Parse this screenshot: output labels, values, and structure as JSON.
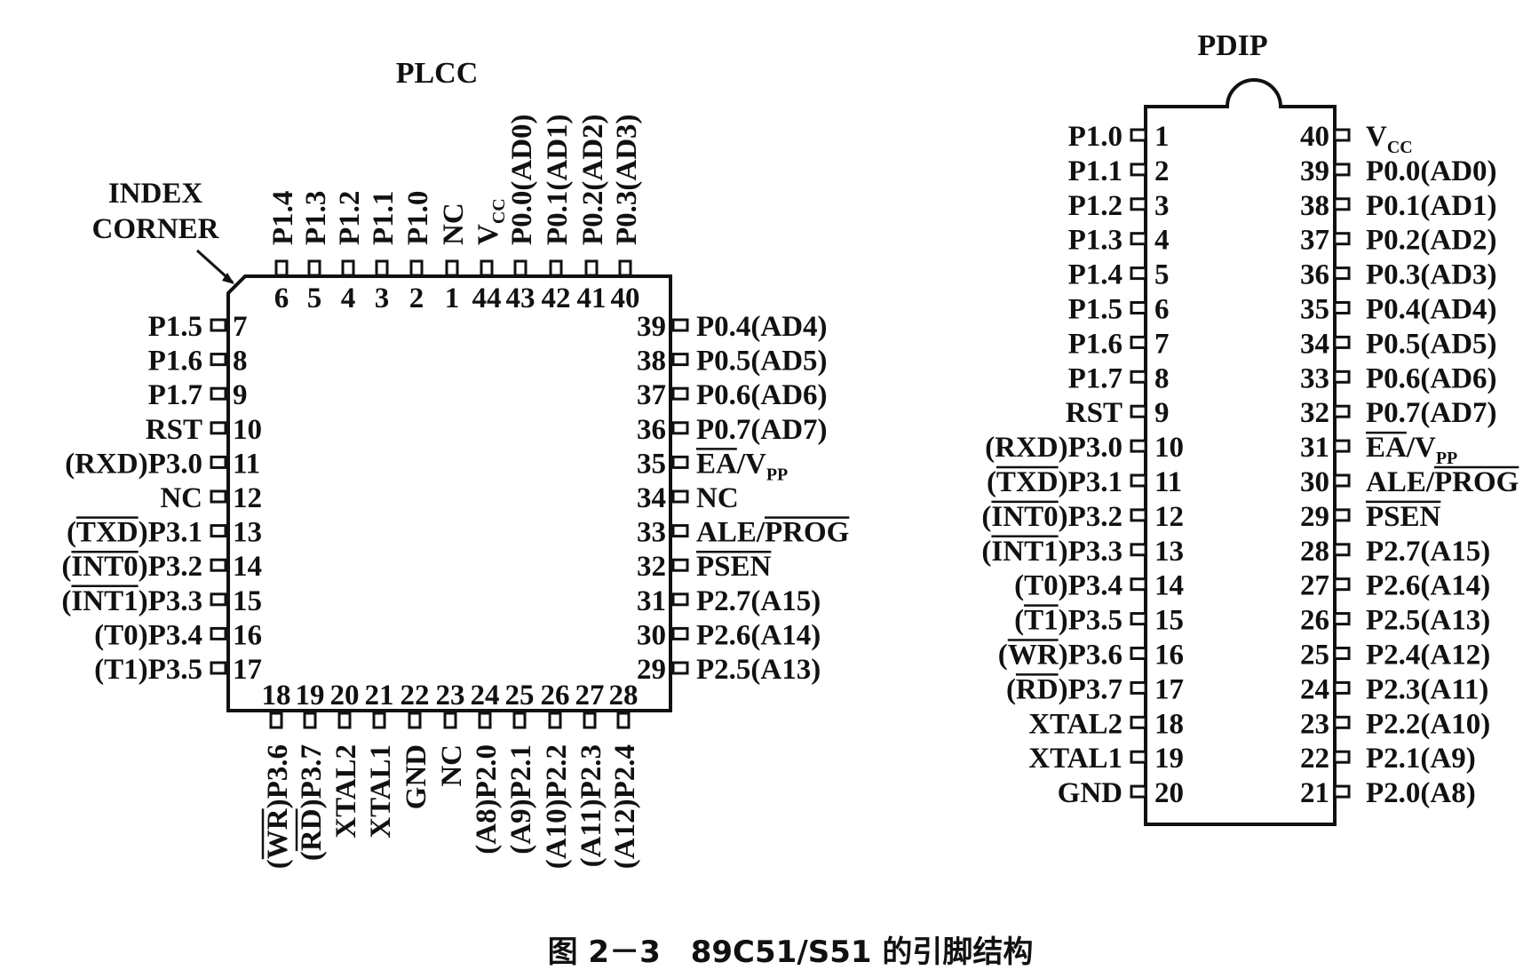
{
  "plcc": {
    "title": "PLCC",
    "index_corner": [
      "INDEX",
      "CORNER"
    ],
    "top": [
      {
        "num": "6",
        "label": "P1.4"
      },
      {
        "num": "5",
        "label": "P1.3"
      },
      {
        "num": "4",
        "label": "P1.2"
      },
      {
        "num": "3",
        "label": "P1.1"
      },
      {
        "num": "2",
        "label": "P1.0"
      },
      {
        "num": "1",
        "label": "NC"
      },
      {
        "num": "44",
        "label": "V",
        "sub": "CC"
      },
      {
        "num": "43",
        "label": "P0.0(AD0)"
      },
      {
        "num": "42",
        "label": "P0.1(AD1)"
      },
      {
        "num": "41",
        "label": "P0.2(AD2)"
      },
      {
        "num": "40",
        "label": "P0.3(AD3)"
      }
    ],
    "left": [
      {
        "num": "7",
        "label": "P1.5"
      },
      {
        "num": "8",
        "label": "P1.6"
      },
      {
        "num": "9",
        "label": "P1.7"
      },
      {
        "num": "10",
        "label": "RST"
      },
      {
        "num": "11",
        "label": "(RXD)P3.0"
      },
      {
        "num": "12",
        "label": "NC"
      },
      {
        "num": "13",
        "label": "(TXD)P3.1",
        "over": "TXD"
      },
      {
        "num": "14",
        "label": "(INT0)P3.2",
        "over": "INT0"
      },
      {
        "num": "15",
        "label": "(INT1)P3.3",
        "over": "INT1"
      },
      {
        "num": "16",
        "label": "(T0)P3.4"
      },
      {
        "num": "17",
        "label": "(T1)P3.5"
      }
    ],
    "right": [
      {
        "num": "39",
        "label": "P0.4(AD4)"
      },
      {
        "num": "38",
        "label": "P0.5(AD5)"
      },
      {
        "num": "37",
        "label": "P0.6(AD6)"
      },
      {
        "num": "36",
        "label": "P0.7(AD7)"
      },
      {
        "num": "35",
        "label": "EA/V",
        "sub": "PP",
        "over": "EA"
      },
      {
        "num": "34",
        "label": "NC"
      },
      {
        "num": "33",
        "label": "ALE/PROG",
        "over": "PROG"
      },
      {
        "num": "32",
        "label": "PSEN",
        "over": "PSEN"
      },
      {
        "num": "31",
        "label": "P2.7(A15)"
      },
      {
        "num": "30",
        "label": "P2.6(A14)"
      },
      {
        "num": "29",
        "label": "P2.5(A13)"
      }
    ],
    "bottom": [
      {
        "num": "18",
        "label": "(WR)P3.6",
        "over": "WR"
      },
      {
        "num": "19",
        "label": "(RD)P3.7",
        "over": "RD"
      },
      {
        "num": "20",
        "label": "XTAL2"
      },
      {
        "num": "21",
        "label": "XTAL1"
      },
      {
        "num": "22",
        "label": "GND"
      },
      {
        "num": "23",
        "label": "NC"
      },
      {
        "num": "24",
        "label": "(A8)P2.0"
      },
      {
        "num": "25",
        "label": "(A9)P2.1"
      },
      {
        "num": "26",
        "label": "(A10)P2.2"
      },
      {
        "num": "27",
        "label": "(A11)P2.3"
      },
      {
        "num": "28",
        "label": "(A12)P2.4"
      }
    ]
  },
  "pdip": {
    "title": "PDIP",
    "left": [
      {
        "num": "1",
        "label": "P1.0"
      },
      {
        "num": "2",
        "label": "P1.1"
      },
      {
        "num": "3",
        "label": "P1.2"
      },
      {
        "num": "4",
        "label": "P1.3"
      },
      {
        "num": "5",
        "label": "P1.4"
      },
      {
        "num": "6",
        "label": "P1.5"
      },
      {
        "num": "7",
        "label": "P1.6"
      },
      {
        "num": "8",
        "label": "P1.7"
      },
      {
        "num": "9",
        "label": "RST"
      },
      {
        "num": "10",
        "label": "(RXD)P3.0"
      },
      {
        "num": "11",
        "label": "(TXD)P3.1",
        "over": "TXD"
      },
      {
        "num": "12",
        "label": "(INT0)P3.2",
        "over": "INT0"
      },
      {
        "num": "13",
        "label": "(INT1)P3.3",
        "over": "INT1"
      },
      {
        "num": "14",
        "label": "(T0)P3.4"
      },
      {
        "num": "15",
        "label": "(T1)P3.5",
        "over": "T1"
      },
      {
        "num": "16",
        "label": "(WR)P3.6",
        "over": "WR"
      },
      {
        "num": "17",
        "label": "(RD)P3.7",
        "over": "RD"
      },
      {
        "num": "18",
        "label": "XTAL2"
      },
      {
        "num": "19",
        "label": "XTAL1"
      },
      {
        "num": "20",
        "label": "GND"
      }
    ],
    "right": [
      {
        "num": "40",
        "label": "V",
        "sub": "CC"
      },
      {
        "num": "39",
        "label": "P0.0(AD0)"
      },
      {
        "num": "38",
        "label": "P0.1(AD1)"
      },
      {
        "num": "37",
        "label": "P0.2(AD2)"
      },
      {
        "num": "36",
        "label": "P0.3(AD3)"
      },
      {
        "num": "35",
        "label": "P0.4(AD4)"
      },
      {
        "num": "34",
        "label": "P0.5(AD5)"
      },
      {
        "num": "33",
        "label": "P0.6(AD6)"
      },
      {
        "num": "32",
        "label": "P0.7(AD7)"
      },
      {
        "num": "31",
        "label": "EA/V",
        "sub": "PP",
        "over": "EA"
      },
      {
        "num": "30",
        "label": "ALE/PROG",
        "over": "PROG"
      },
      {
        "num": "29",
        "label": "PSEN",
        "over": "PSEN"
      },
      {
        "num": "28",
        "label": "P2.7(A15)"
      },
      {
        "num": "27",
        "label": "P2.6(A14)"
      },
      {
        "num": "26",
        "label": "P2.5(A13)"
      },
      {
        "num": "25",
        "label": "P2.4(A12)"
      },
      {
        "num": "24",
        "label": "P2.3(A11)"
      },
      {
        "num": "23",
        "label": "P2.2(A10)"
      },
      {
        "num": "22",
        "label": "P2.1(A9)"
      },
      {
        "num": "21",
        "label": "P2.0(A8)"
      }
    ]
  },
  "caption": "图 2－3　89C51/S51 的引脚结构"
}
